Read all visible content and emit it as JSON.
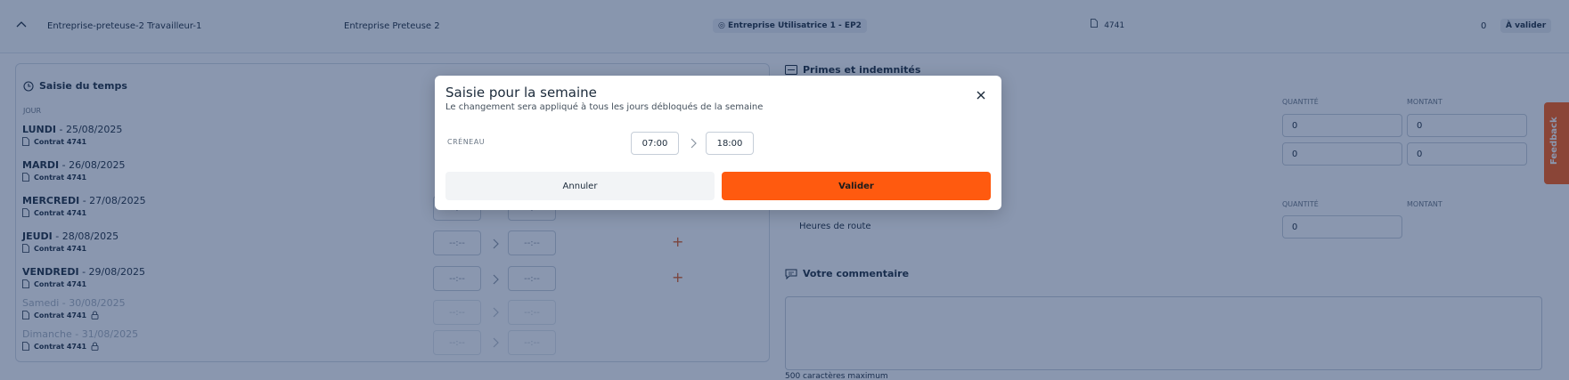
{
  "row": {
    "name": "Entreprise-preteuse-2 Travailleur-1",
    "company": "Entreprise Preteuse 2",
    "client_chip": "Entreprise Utilisatrice 1 - EP2",
    "contract_number": "4741",
    "count": "0",
    "status": "À valider"
  },
  "time_entry": {
    "title": "Saisie du temps",
    "col_jour": "JOUR",
    "contract_label": "Contrat 4741",
    "time_placeholder": "--:--",
    "plus": "+",
    "days": [
      {
        "name": "LUNDI",
        "date": " - 25/08/2025"
      },
      {
        "name": "MARDI",
        "date": " - 26/08/2025"
      },
      {
        "name": "MERCREDI",
        "date": " - 27/08/2025"
      },
      {
        "name": "JEUDI",
        "date": " - 28/08/2025"
      },
      {
        "name": "VENDREDI",
        "date": " - 29/08/2025"
      },
      {
        "name": "Samedi",
        "date": " - 30/08/2025"
      },
      {
        "name": "Dimanche",
        "date": " - 31/08/2025"
      }
    ]
  },
  "primes": {
    "title": "Primes et indemnités",
    "col_quantite": "QUANTITÉ",
    "col_montant": "MONTANT",
    "row1_quantite": "0",
    "row1_montant": "0",
    "row2_quantite": "0",
    "row2_montant": "0"
  },
  "route": {
    "col_quantite": "QUANTITÉ",
    "col_montant": "MONTANT",
    "label": "Heures de route",
    "quantite": "0"
  },
  "comment": {
    "title": "Votre commentaire",
    "hint": "500 caractères maximum"
  },
  "feedback": {
    "label": "Feedback"
  },
  "modal": {
    "title": "Saisie pour la semaine",
    "subtitle": "Le changement sera appliqué à tous les jours débloqués de la semaine",
    "creneau_label": "CRÉNEAU",
    "start_time": "07:00",
    "end_time": "18:00",
    "cancel_label": "Annuler",
    "validate_label": "Valider"
  },
  "colors": {
    "accent": "#ff5a0f",
    "overlay": "#163060"
  }
}
